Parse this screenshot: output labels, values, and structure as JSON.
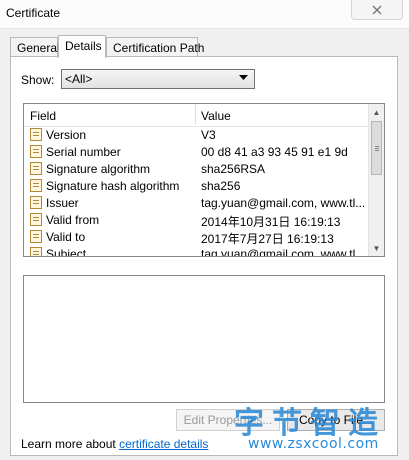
{
  "window": {
    "title": "Certificate"
  },
  "tabs": [
    {
      "label": "General"
    },
    {
      "label": "Details"
    },
    {
      "label": "Certification Path"
    }
  ],
  "show": {
    "label": "Show:",
    "selected": "<All>"
  },
  "list": {
    "columns": {
      "field": "Field",
      "value": "Value"
    },
    "rows": [
      {
        "field": "Version",
        "value": "V3"
      },
      {
        "field": "Serial number",
        "value": "00 d8 41 a3 93 45 91 e1 9d"
      },
      {
        "field": "Signature algorithm",
        "value": "sha256RSA"
      },
      {
        "field": "Signature hash algorithm",
        "value": "sha256"
      },
      {
        "field": "Issuer",
        "value": "tag.yuan@gmail.com, www.tl..."
      },
      {
        "field": "Valid from",
        "value": "2014年10月31日 16:19:13"
      },
      {
        "field": "Valid to",
        "value": "2017年7月27日 16:19:13"
      },
      {
        "field": "Subject",
        "value": "tag.yuan@gmail.com, www.tl..."
      }
    ]
  },
  "buttons": {
    "edit": "Edit Properties...",
    "copy": "Copy to File..."
  },
  "footer": {
    "learn_prefix": "Learn more about ",
    "learn_link": "certificate details"
  },
  "watermark": {
    "main": "字节智造",
    "url": "www.zsxcool.com"
  },
  "colors": {
    "link": "#0066cc",
    "watermark": "#2b8ad6"
  }
}
